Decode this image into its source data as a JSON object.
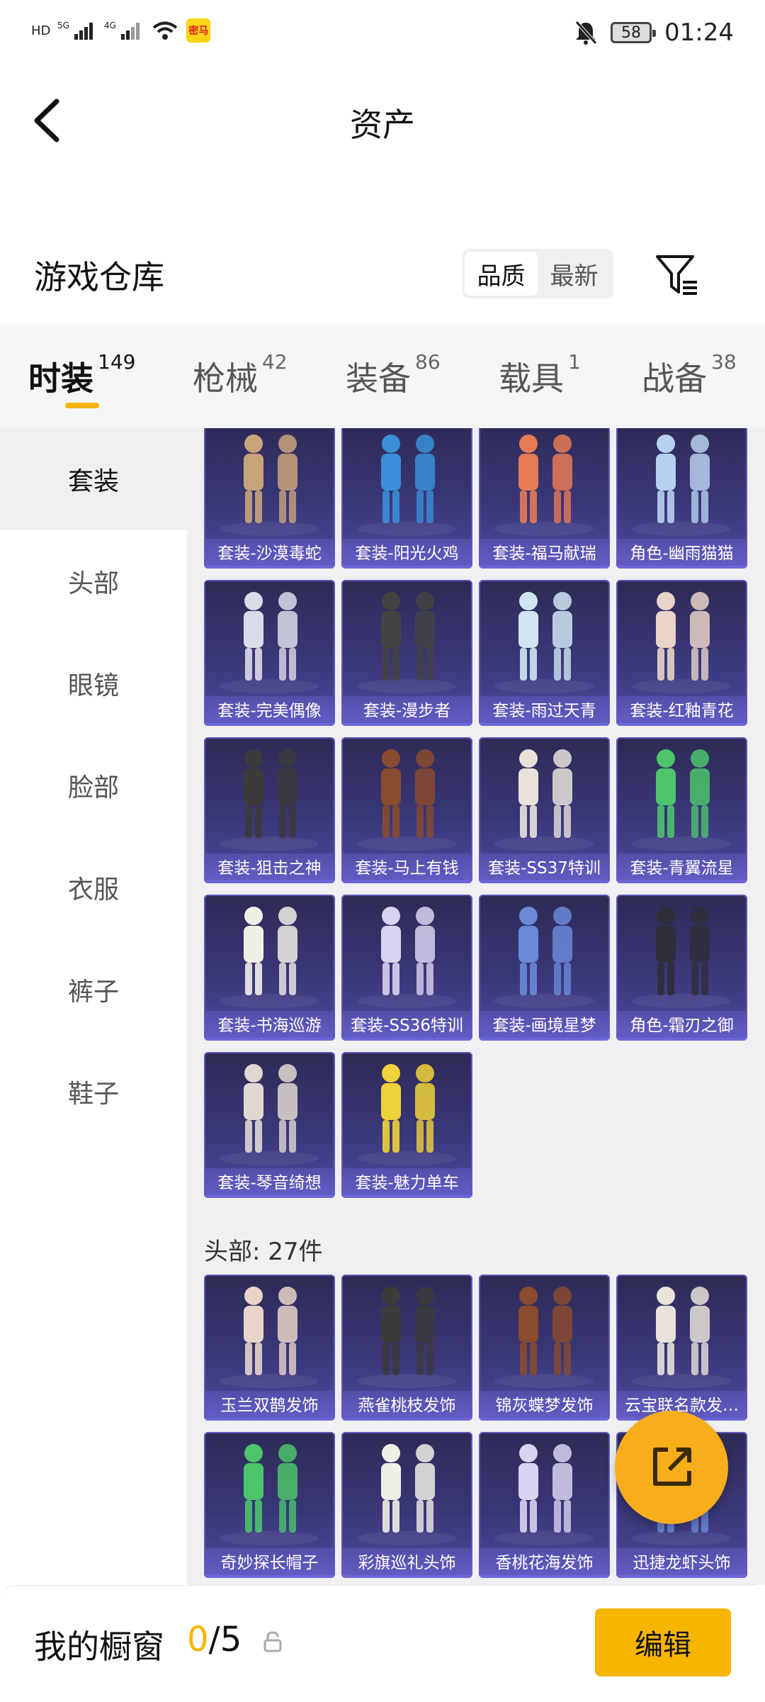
{
  "status_bar": {
    "network_left": [
      "HD",
      "5G",
      "4G"
    ],
    "battery": "58",
    "time": "01:24",
    "app_badge": "密马"
  },
  "header": {
    "title": "资产"
  },
  "warehouse": {
    "title": "游戏仓库",
    "sort_options": [
      "品质",
      "最新"
    ],
    "sort_active": "品质"
  },
  "tabs": [
    {
      "label": "时装",
      "count": "149"
    },
    {
      "label": "枪械",
      "count": "42"
    },
    {
      "label": "装备",
      "count": "86"
    },
    {
      "label": "载具",
      "count": "1"
    },
    {
      "label": "战备",
      "count": "38"
    }
  ],
  "sidebar": [
    "套装",
    "头部",
    "眼镜",
    "脸部",
    "衣服",
    "裤子",
    "鞋子"
  ],
  "sections": [
    {
      "title": "",
      "items": [
        "套装-沙漠毒蛇",
        "套装-阳光火鸡",
        "套装-福马献瑞",
        "角色-幽雨猫猫",
        "套装-完美偶像",
        "套装-漫步者",
        "套装-雨过天青",
        "套装-红釉青花",
        "套装-狙击之神",
        "套装-马上有钱",
        "套装-SS37特训",
        "套装-青翼流星",
        "套装-书海巡游",
        "套装-SS36特训",
        "套装-画境星梦",
        "角色-霜刃之御",
        "套装-琴音绮想",
        "套装-魅力单车"
      ]
    },
    {
      "title": "头部: 27件",
      "items": [
        "玉兰双鹊发饰",
        "燕雀桃枝发饰",
        "锦灰蝶梦发饰",
        "云宝联名款发…",
        "奇妙探长帽子",
        "彩旗巡礼头饰",
        "香桃花海发饰",
        "迅捷龙虾头饰"
      ]
    }
  ],
  "bottom": {
    "title": "我的橱窗",
    "count_current": "0",
    "count_total": "/5",
    "edit_label": "编辑"
  },
  "colors": {
    "accent": "#f5b400",
    "card_bg": "#3a3779",
    "card_border": "#5b58b7"
  }
}
